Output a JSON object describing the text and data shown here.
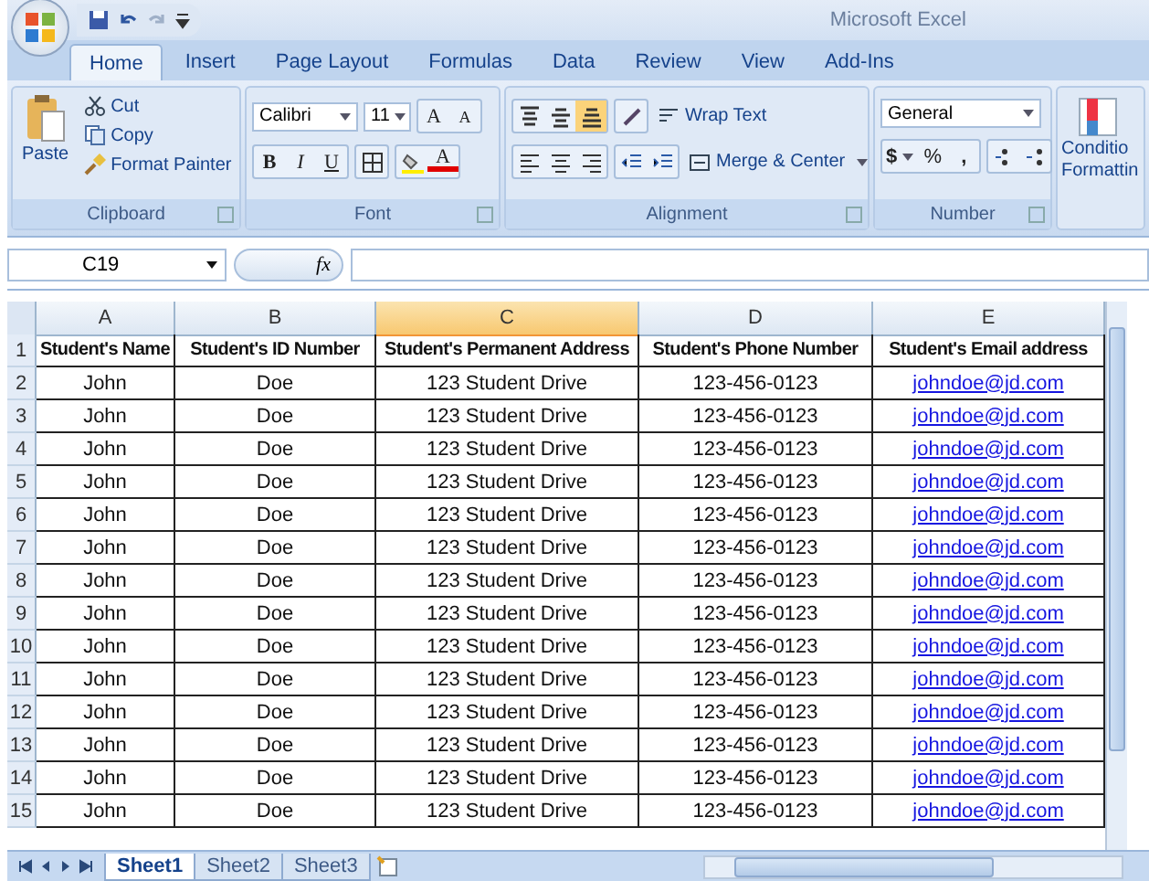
{
  "window": {
    "title": "Microsoft Excel"
  },
  "ribbon_tabs": [
    {
      "label": "Home",
      "selected": true
    },
    {
      "label": "Insert",
      "selected": false
    },
    {
      "label": "Page Layout",
      "selected": false
    },
    {
      "label": "Formulas",
      "selected": false
    },
    {
      "label": "Data",
      "selected": false
    },
    {
      "label": "Review",
      "selected": false
    },
    {
      "label": "View",
      "selected": false
    },
    {
      "label": "Add-Ins",
      "selected": false
    }
  ],
  "clipboard": {
    "label": "Clipboard",
    "paste": "Paste",
    "cut": "Cut",
    "copy": "Copy",
    "format_painter": "Format Painter"
  },
  "font": {
    "label": "Font",
    "family": "Calibri",
    "size": "11",
    "grow": "A",
    "shrink": "A",
    "bold": "B",
    "italic": "I",
    "underline": "U",
    "font_color": "A"
  },
  "alignment": {
    "label": "Alignment",
    "wrap_text": "Wrap Text",
    "merge_center": "Merge & Center"
  },
  "number": {
    "label": "Number",
    "format": "General",
    "currency": "$",
    "percent": "%",
    "comma": ","
  },
  "styles": {
    "conditional_line1": "Conditio",
    "conditional_line2": "Formattin"
  },
  "formula_bar": {
    "name_box": "C19",
    "fx": "fx"
  },
  "sheet": {
    "columns": [
      {
        "label": "A",
        "selected": false
      },
      {
        "label": "B",
        "selected": false
      },
      {
        "label": "C",
        "selected": true
      },
      {
        "label": "D",
        "selected": false
      },
      {
        "label": "E",
        "selected": false
      }
    ],
    "rows": [
      {
        "number": "1",
        "kind": "header",
        "cells": [
          "Student's Name",
          "Student's ID Number",
          "Student's Permanent Address",
          "Student's Phone Number",
          "Student's Email address"
        ]
      },
      {
        "number": "2",
        "kind": "data",
        "cells": [
          "John",
          "Doe",
          "123 Student Drive",
          "123-456-0123",
          "johndoe@jd.com"
        ]
      },
      {
        "number": "3",
        "kind": "data",
        "cells": [
          "John",
          "Doe",
          "123 Student Drive",
          "123-456-0123",
          "johndoe@jd.com"
        ]
      },
      {
        "number": "4",
        "kind": "data",
        "cells": [
          "John",
          "Doe",
          "123 Student Drive",
          "123-456-0123",
          "johndoe@jd.com"
        ]
      },
      {
        "number": "5",
        "kind": "data",
        "cells": [
          "John",
          "Doe",
          "123 Student Drive",
          "123-456-0123",
          "johndoe@jd.com"
        ]
      },
      {
        "number": "6",
        "kind": "data",
        "cells": [
          "John",
          "Doe",
          "123 Student Drive",
          "123-456-0123",
          "johndoe@jd.com"
        ]
      },
      {
        "number": "7",
        "kind": "data",
        "cells": [
          "John",
          "Doe",
          "123 Student Drive",
          "123-456-0123",
          "johndoe@jd.com"
        ]
      },
      {
        "number": "8",
        "kind": "data",
        "cells": [
          "John",
          "Doe",
          "123 Student Drive",
          "123-456-0123",
          "johndoe@jd.com"
        ]
      },
      {
        "number": "9",
        "kind": "data",
        "cells": [
          "John",
          "Doe",
          "123 Student Drive",
          "123-456-0123",
          "johndoe@jd.com"
        ]
      },
      {
        "number": "10",
        "kind": "data",
        "cells": [
          "John",
          "Doe",
          "123 Student Drive",
          "123-456-0123",
          "johndoe@jd.com"
        ]
      },
      {
        "number": "11",
        "kind": "data",
        "cells": [
          "John",
          "Doe",
          "123 Student Drive",
          "123-456-0123",
          "johndoe@jd.com"
        ]
      },
      {
        "number": "12",
        "kind": "data",
        "cells": [
          "John",
          "Doe",
          "123 Student Drive",
          "123-456-0123",
          "johndoe@jd.com"
        ]
      },
      {
        "number": "13",
        "kind": "data",
        "cells": [
          "John",
          "Doe",
          "123 Student Drive",
          "123-456-0123",
          "johndoe@jd.com"
        ]
      },
      {
        "number": "14",
        "kind": "data",
        "cells": [
          "John",
          "Doe",
          "123 Student Drive",
          "123-456-0123",
          "johndoe@jd.com"
        ]
      },
      {
        "number": "15",
        "kind": "data",
        "cells": [
          "John",
          "Doe",
          "123 Student Drive",
          "123-456-0123",
          "johndoe@jd.com"
        ]
      }
    ]
  },
  "sheet_tabs": [
    {
      "label": "Sheet1",
      "selected": true
    },
    {
      "label": "Sheet2",
      "selected": false
    },
    {
      "label": "Sheet3",
      "selected": false
    }
  ]
}
